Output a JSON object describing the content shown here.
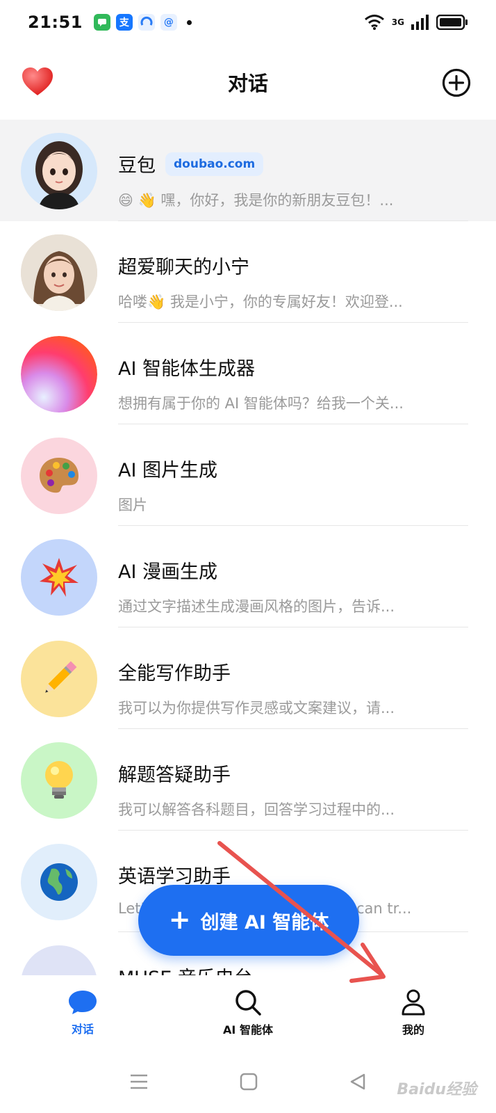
{
  "status_bar": {
    "time": "21:51",
    "network": "3G"
  },
  "header": {
    "title": "对话"
  },
  "conversations": [
    {
      "title": "豆包",
      "badge": "doubao.com",
      "message": "😄 👋 嘿，你好，我是你的新朋友豆包！...",
      "avatar_color": "#d6e8fb",
      "avatar_icon": "girl-avatar"
    },
    {
      "title": "超爱聊天的小宁",
      "message": "哈喽👋 我是小宁，你的专属好友！欢迎登...",
      "avatar_color": "#e8dccf",
      "avatar_icon": "woman-avatar"
    },
    {
      "title": "AI 智能体生成器",
      "message": "想拥有属于你的 AI 智能体吗？给我一个关...",
      "avatar_color": "#ff5a3c",
      "avatar_icon": "gradient-orb"
    },
    {
      "title": "AI 图片生成",
      "message": "图片",
      "avatar_color": "#fbd6de",
      "avatar_icon": "palette",
      "avatar_glyph": "🎨"
    },
    {
      "title": "AI 漫画生成",
      "message": "通过文字描述生成漫画风格的图片，告诉...",
      "avatar_color": "#c3d6fb",
      "avatar_icon": "explosion",
      "avatar_glyph": "💥"
    },
    {
      "title": "全能写作助手",
      "message": "我可以为你提供写作灵感或文案建议，请...",
      "avatar_color": "#fbe39a",
      "avatar_icon": "pencil",
      "avatar_glyph": "✏️"
    },
    {
      "title": "解题答疑助手",
      "message": "我可以解答各科题目，回答学习过程中的...",
      "avatar_color": "#c9f6c6",
      "avatar_icon": "light-bulb",
      "avatar_glyph": "💡"
    },
    {
      "title": "英语学习助手",
      "message": "Let's learn English together. You can tr...",
      "avatar_color": "#e1eefb",
      "avatar_icon": "globe",
      "avatar_glyph": "🌍"
    },
    {
      "title": "MUSE 音乐电台",
      "message": "",
      "avatar_color": "#dfe3f6",
      "avatar_icon": "music"
    }
  ],
  "fab": {
    "plus": "+",
    "label": "创建 AI 智能体"
  },
  "bottom_nav": [
    {
      "label": "对话",
      "icon": "chat-bubble",
      "active": true
    },
    {
      "label": "AI 智能体",
      "icon": "search",
      "active": false
    },
    {
      "label": "我的",
      "icon": "user",
      "active": false
    }
  ],
  "watermark": "Baidu经验",
  "colors": {
    "accent": "#1e6ff1",
    "badge_bg": "#e3eefe",
    "active_row": "#f3f3f4",
    "arrow": "#e8534f"
  }
}
